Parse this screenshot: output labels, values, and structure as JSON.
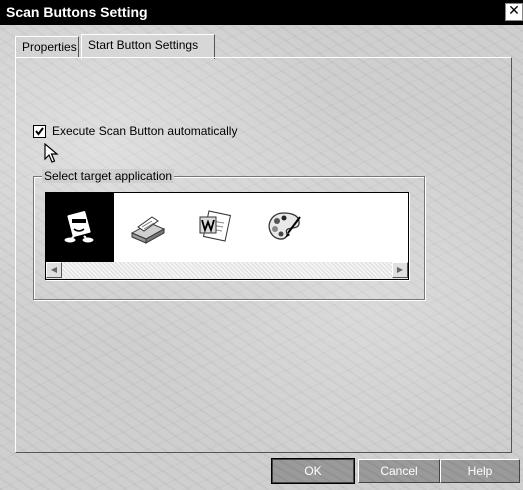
{
  "window": {
    "title": "Scan Buttons Setting",
    "close_glyph": "✕"
  },
  "tabs": [
    {
      "label": "Properties",
      "selected": false
    },
    {
      "label": "Start Button Settings",
      "selected": true
    }
  ],
  "auto_execute": {
    "label": "Execute Scan Button automatically",
    "checked": true
  },
  "target_group": {
    "legend": "Select target application",
    "apps": [
      {
        "icon": "scanner-mascot-icon",
        "selected": true
      },
      {
        "icon": "fax-machine-icon",
        "selected": false
      },
      {
        "icon": "word-document-icon",
        "selected": false
      },
      {
        "icon": "paint-palette-icon",
        "selected": false
      }
    ],
    "scroll_left_glyph": "◀",
    "scroll_right_glyph": "▶"
  },
  "buttons": {
    "ok": "OK",
    "cancel": "Cancel",
    "help": "Help"
  }
}
